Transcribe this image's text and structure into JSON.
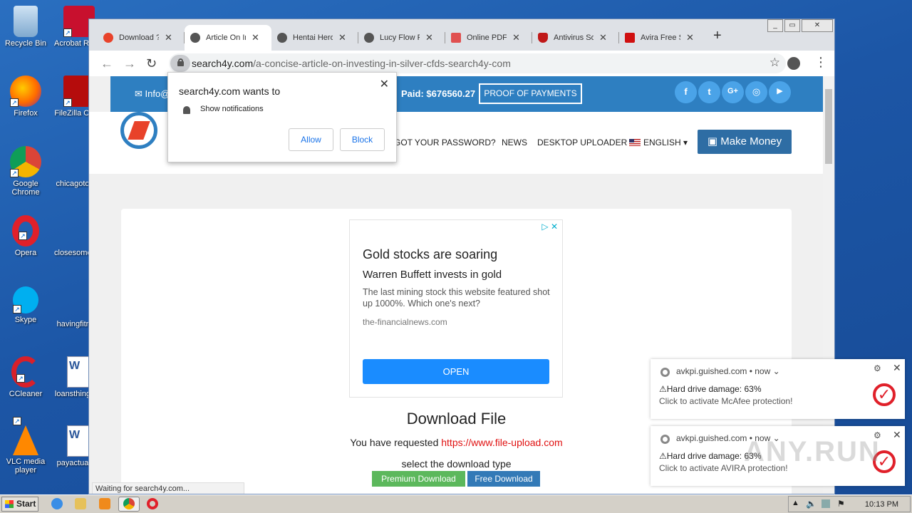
{
  "desktop": {
    "icons": [
      {
        "label": "Recycle Bin"
      },
      {
        "label": "Acrobat Reader"
      },
      {
        "label": "Firefox"
      },
      {
        "label": "FileZilla Cl"
      },
      {
        "label": "Google Chrome"
      },
      {
        "label": "chicagoto"
      },
      {
        "label": "Opera"
      },
      {
        "label": "closesome"
      },
      {
        "label": "Skype"
      },
      {
        "label": "havingfitr"
      },
      {
        "label": "CCleaner"
      },
      {
        "label": "loansthing"
      },
      {
        "label": "VLC media player"
      },
      {
        "label": "payactua"
      }
    ]
  },
  "browser": {
    "tabs": [
      {
        "title": "Download ?",
        "favicon_color": "#e8422a"
      },
      {
        "title": "Article On In",
        "favicon_color": "#555555"
      },
      {
        "title": "Hentai Hero",
        "favicon_color": "#555555"
      },
      {
        "title": "Lucy Flow P",
        "favicon_color": "#555555"
      },
      {
        "title": "Online PDF",
        "favicon_color": "#e05050"
      },
      {
        "title": "Antivirus So",
        "favicon_color": "#c01818"
      },
      {
        "title": "Avira Free S",
        "favicon_color": "#d01010"
      }
    ],
    "new_tab": "+",
    "url_domain": "search4y.com",
    "url_path": "/a-concise-article-on-investing-in-silver-cfds-search4y-com",
    "status": "Waiting for search4y.com..."
  },
  "permission": {
    "title": "search4y.com wants to",
    "option": "Show notifications",
    "allow": "Allow",
    "block": "Block",
    "close": "✕"
  },
  "site": {
    "info": "✉ Info@",
    "paid": "Paid: $676560.27",
    "proof": "PROOF OF PAYMENTS",
    "social": [
      "f",
      "t",
      "G+",
      "◎",
      "▶"
    ],
    "nav": [
      "GOT YOUR PASSWORD?",
      "NEWS",
      "DESKTOP UPLOADER",
      "ENGLISH ▾"
    ],
    "make_money": "▣ Make Money",
    "ad": {
      "headline": "Gold stocks are soaring",
      "subhead": "Warren Buffett invests in gold",
      "body": "The last mining stock this website featured shot up 1000%. Which one's next?",
      "domain": "the-financialnews.com",
      "cta": "OPEN",
      "adchoices": "▷ ✕"
    },
    "download_title": "Download File",
    "requested_prefix": "You have requested",
    "requested_link": "https://www.file-upload.com",
    "select_type": "select the download type",
    "premium": "Premium Download",
    "free": "Free Download"
  },
  "toasts": [
    {
      "source": "avkpi.guished.com • now ⌄",
      "headline": "⚠Hard drive damage: 63%",
      "sub": "Click to activate McAfee protection!"
    },
    {
      "source": "avkpi.guished.com • now ⌄",
      "headline": "⚠Hard drive damage: 63%",
      "sub": "Click to activate AVIRA protection!"
    }
  ],
  "taskbar": {
    "start": "Start",
    "clock": "10:13 PM"
  },
  "watermark": "ANY.RUN"
}
